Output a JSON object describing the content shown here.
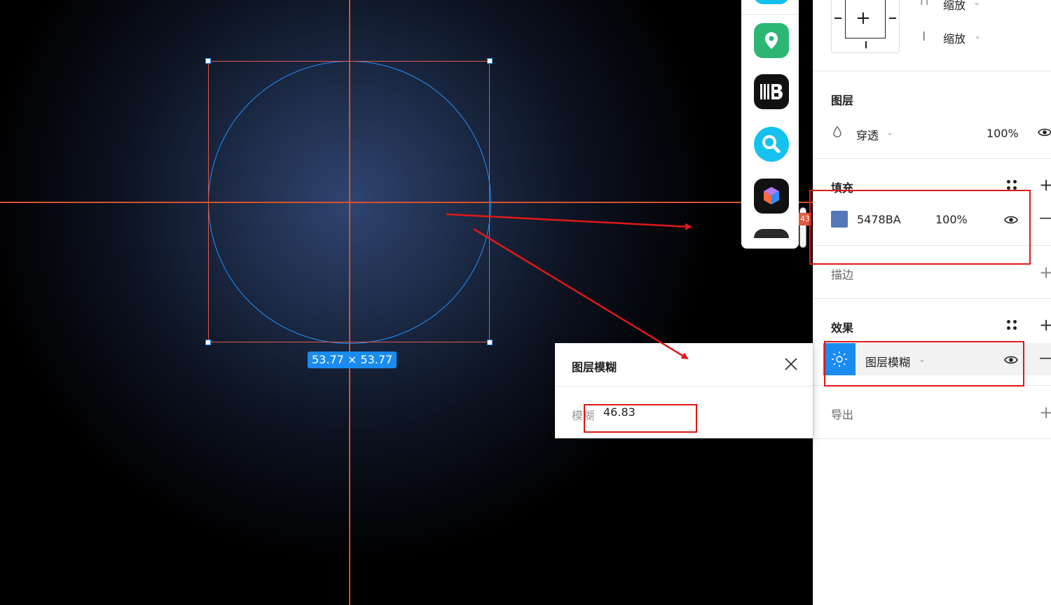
{
  "canvas": {
    "size_label": "53.77 × 53.77"
  },
  "dock": {
    "apps": [
      {
        "name": "map-pin-app",
        "color": "#2bb673"
      },
      {
        "name": "iiib-app",
        "color": "#111111"
      },
      {
        "name": "search-app",
        "color": "#14c1ef"
      },
      {
        "name": "cube-app",
        "color": "#111111"
      }
    ],
    "edge_label": "43"
  },
  "panel": {
    "resize_labels": [
      "缩放",
      "缩放"
    ],
    "layer": {
      "title": "图层",
      "blend_mode": "穿透",
      "opacity": "100%"
    },
    "fill": {
      "title": "填充",
      "color_hex": "5478BA",
      "swatch": "#5478BA",
      "opacity": "100%"
    },
    "stroke": {
      "title": "描边"
    },
    "effects": {
      "title": "效果",
      "item_label": "图层模糊"
    },
    "export": {
      "title": "导出"
    }
  },
  "popup": {
    "title": "图层模糊",
    "field_label": "模糊",
    "field_value": "46.83"
  },
  "annotation_color": "#e01818"
}
